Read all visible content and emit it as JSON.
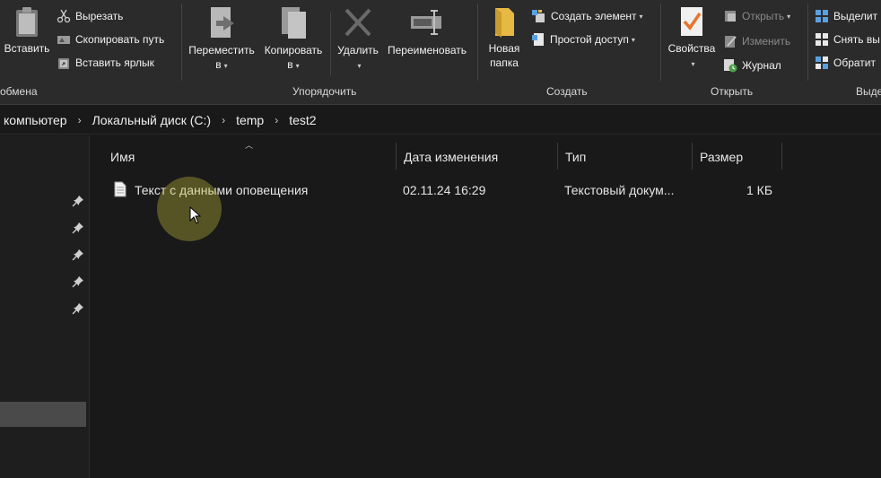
{
  "ribbon": {
    "clipboard": {
      "label": "обмена",
      "paste": "Вставить",
      "cut": "Вырезать",
      "copy_path": "Скопировать путь",
      "paste_shortcut": "Вставить ярлык"
    },
    "organize": {
      "label": "Упорядочить",
      "move_to_line1": "Переместить",
      "move_to_line2": "в",
      "copy_to_line1": "Копировать",
      "copy_to_line2": "в",
      "delete": "Удалить",
      "rename": "Переименовать"
    },
    "new": {
      "label": "Создать",
      "new_folder_line1": "Новая",
      "new_folder_line2": "папка",
      "new_item": "Создать элемент",
      "easy_access": "Простой доступ"
    },
    "open": {
      "label": "Открыть",
      "properties": "Свойства",
      "open": "Открыть",
      "edit": "Изменить",
      "history": "Журнал"
    },
    "select": {
      "label": "Выде",
      "select_all": "Выделит",
      "select_none": "Снять вы",
      "invert": "Обратит"
    }
  },
  "address": {
    "crumbs": [
      "компьютер",
      "Локальный диск (C:)",
      "temp",
      "test2"
    ]
  },
  "columns": {
    "name": "Имя",
    "modified": "Дата изменения",
    "type": "Тип",
    "size": "Размер"
  },
  "files": [
    {
      "name": "Текст с данными оповещения",
      "modified": "02.11.24 16:29",
      "type": "Текстовый докум...",
      "size": "1 КБ"
    }
  ],
  "colors": {
    "background": "#191919",
    "ribbon": "#2b2b2b",
    "folder": "#e8b844",
    "properties_check": "#e8732c"
  }
}
